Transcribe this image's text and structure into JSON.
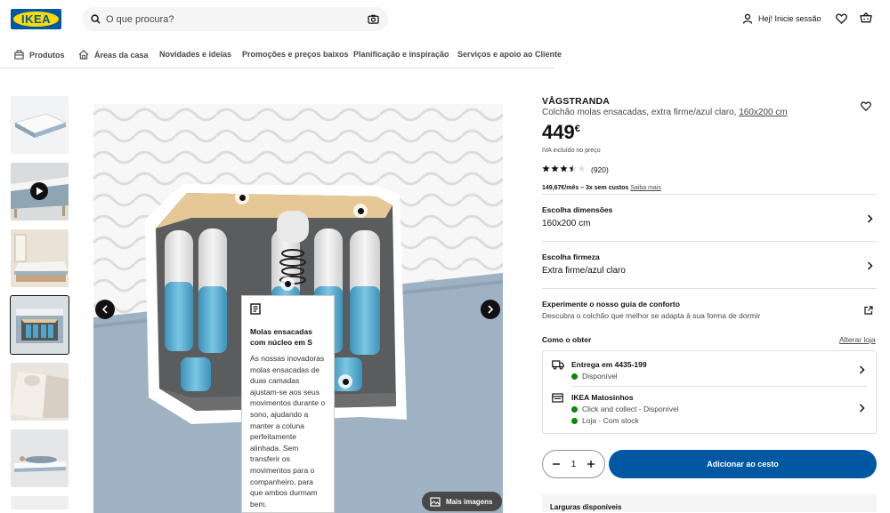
{
  "header": {
    "logo_text": "IKEA",
    "search_placeholder": "O que procura?",
    "login_label": "Hej! Inicie sessão"
  },
  "nav": {
    "items": [
      {
        "label": "Produtos",
        "icon": "products-icon"
      },
      {
        "label": "Áreas da casa",
        "icon": "home-icon"
      },
      {
        "label": "Novidades e ideias"
      },
      {
        "label": "Promoções e preços baixos"
      },
      {
        "label": "Planificação e inspiração"
      },
      {
        "label": "Serviços e apoio ao Cliente"
      }
    ]
  },
  "gallery": {
    "callout_title": "Molas ensacadas com núcleo em S",
    "callout_text": "As nossas inovadoras molas ensacadas de duas camadas ajustam-se aos seus movimentos durante o sono, ajudando a manter a coluna perfeitamente alinhada. Sem transferir os movimentos para o companheiro, para que ambos durmam bem.",
    "more_images_label": "Mais imagens"
  },
  "product": {
    "name": "VÅGSTRANDA",
    "description": "Colchão molas ensacadas, extra firme/azul claro,",
    "size_link": "160x200 cm",
    "price": "449",
    "currency": "€",
    "vat_note": "IVA incluído no preço",
    "rating_count": "(920)",
    "rating": 3.5,
    "installment_bold": "149,67€/mês – 3x sem custos",
    "installment_link": "Saiba mais"
  },
  "options": {
    "size_heading": "Escolha dimensões",
    "size_value": "160x200 cm",
    "firmness_heading": "Escolha firmeza",
    "firmness_value": "Extra firme/azul claro",
    "guide_heading": "Experimente o nosso guia de conforto",
    "guide_text": "Descubra o colchão que melhor se adapta à sua forma de dormir"
  },
  "delivery": {
    "heading": "Como o obter",
    "change_store": "Alterar loja",
    "delivery_title": "Entrega em 4435-199",
    "delivery_status": "Disponível",
    "store_title": "IKEA Matosinhos",
    "store_status_1": "Click and collect - Disponível",
    "store_status_2": "Loja - Com stock"
  },
  "cart": {
    "quantity": "1",
    "add_label": "Adicionar ao cesto"
  },
  "bottom": {
    "label": "Larguras disponíveis"
  },
  "colors": {
    "brand_blue": "#0058a3",
    "brand_yellow": "#ffdb00",
    "available_green": "#0a8a00"
  }
}
